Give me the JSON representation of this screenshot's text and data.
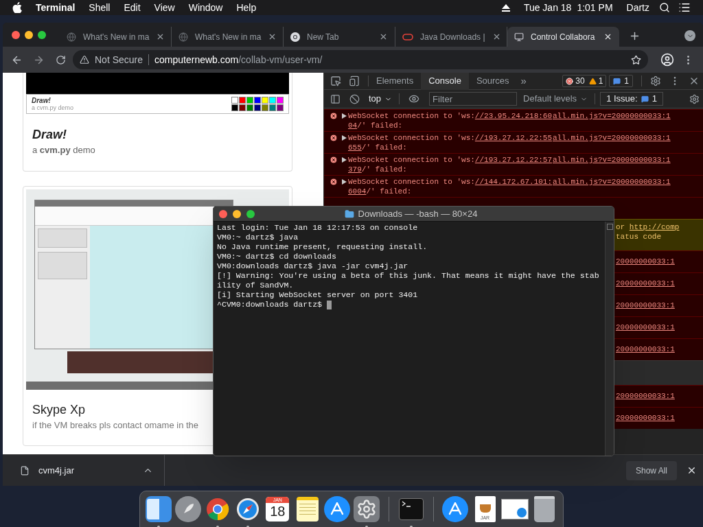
{
  "menu_bar": {
    "app": "Terminal",
    "menus": [
      "Shell",
      "Edit",
      "View",
      "Window",
      "Help"
    ],
    "date": "Tue Jan 18",
    "time": "1:01 PM",
    "user": "Dartz"
  },
  "browser": {
    "tabs": [
      {
        "title": "What's New in ma",
        "kind": "globe",
        "selected": false
      },
      {
        "title": "What's New in ma",
        "kind": "globe",
        "selected": false
      },
      {
        "title": "New Tab",
        "kind": "chrome",
        "selected": false
      },
      {
        "title": "Java Downloads |",
        "kind": "ring",
        "selected": false
      },
      {
        "title": "Control Collabora",
        "kind": "computer",
        "selected": true
      }
    ],
    "address": {
      "security": "Not Secure",
      "domain": "computernewb.com",
      "path": "/collab-vm/user-vm/"
    },
    "page": {
      "cards": [
        {
          "kind": "draw",
          "thumb_title": "Draw!",
          "thumb_caption": "a cvm.py demo",
          "title": "Draw!",
          "description": "a **cvm.py** demo",
          "palette": [
            {
              "color": "#ffffff"
            },
            {
              "color": "#ff0000"
            },
            {
              "color": "#00cc00"
            },
            {
              "color": "#0000ff"
            },
            {
              "color": "#ffff00"
            },
            {
              "color": "#00ffff"
            },
            {
              "color": "#ff00ff"
            },
            {
              "color": "#000000"
            },
            {
              "color": "#800000"
            },
            {
              "color": "#008000"
            },
            {
              "color": "#000080"
            },
            {
              "color": "#808000"
            },
            {
              "color": "#008080"
            },
            {
              "color": "#800080"
            }
          ]
        },
        {
          "kind": "vm",
          "title": "Skype Xp",
          "description": "if the VM breaks pls contact omame in the"
        }
      ]
    },
    "devtools": {
      "tabs": [
        {
          "label": "Elements",
          "selected": false
        },
        {
          "label": "Console",
          "selected": true
        },
        {
          "label": "Sources",
          "selected": false
        }
      ],
      "more": "»",
      "error_count": "30",
      "warning_count": "1",
      "message_count": "1",
      "context": "top",
      "filter_placeholder": "Filter",
      "levels": "Default levels",
      "issues_label": "1 Issue:",
      "issues_count": "1",
      "messages": [
        {
          "text": "WebSocket connection to 'ws:",
          "url_1": "//23.95.24.218:60",
          "url_2": "04",
          "tail": "/' failed:",
          "source": "all.min.js?v=20000000033:1"
        },
        {
          "text": "WebSocket connection to 'ws:",
          "url_1": "//193.27.12.22:55",
          "url_2": "655",
          "tail": "/' failed:",
          "source": "all.min.js?v=20000000033:1"
        },
        {
          "text": "WebSocket connection to 'ws:",
          "url_1": "//193.27.12.22:57",
          "url_2": "379",
          "tail": "/' failed:",
          "source": "all.min.js?v=20000000033:1"
        },
        {
          "text": "WebSocket connection to 'ws:",
          "url_1": "//144.172.67.101:",
          "url_2": "6004",
          "tail": "/' failed:",
          "source": "all.min.js?v=20000000033:1"
        }
      ],
      "partial_rows": [
        {
          "kind": "error"
        },
        {
          "kind": "warning",
          "text": "or",
          "link": "http://comp",
          "text_2": "tatus code"
        },
        {
          "kind": "error",
          "link": "20000000033:1"
        },
        {
          "kind": "error",
          "link": "20000000033:1"
        },
        {
          "kind": "error",
          "link": "20000000033:1"
        },
        {
          "kind": "error",
          "link": "20000000033:1"
        },
        {
          "kind": "error",
          "link": "20000000033:1"
        },
        {
          "kind": "blank"
        },
        {
          "kind": "error",
          "link": "20000000033:1"
        },
        {
          "kind": "error",
          "link": "20000000033:1"
        }
      ]
    },
    "downloads": {
      "file": "cvm4j.jar",
      "show_all": "Show All"
    }
  },
  "terminal": {
    "title": "Downloads — -bash — 80×24",
    "lines": [
      "Last login: Tue Jan 18 12:17:53 on console",
      "VM0:~ dartz$ java",
      "No Java runtime present, requesting install.",
      "VM0:~ dartz$ cd downloads",
      "VM0:downloads dartz$ java -jar cvm4j.jar",
      "[!] Warning: You're using a beta of this junk. That means it might have the stab",
      "ility of SandVM.",
      "[i] Starting WebSocket server on port 3401",
      "^CVM0:downloads dartz$"
    ]
  },
  "dock": {
    "items": [
      {
        "kind": "finder",
        "running": true
      },
      {
        "kind": "launchpad",
        "running": false
      },
      {
        "kind": "chrome",
        "running": true
      },
      {
        "kind": "safari",
        "running": true
      },
      {
        "kind": "calendar",
        "month": "JAN",
        "day": "18",
        "running": false
      },
      {
        "kind": "notes",
        "running": false
      },
      {
        "kind": "appstore",
        "running": false
      },
      {
        "kind": "settings",
        "running": true
      },
      {
        "kind": "separator"
      },
      {
        "kind": "terminal",
        "running": true
      },
      {
        "kind": "separator"
      },
      {
        "kind": "downloads",
        "running": false
      },
      {
        "kind": "jar",
        "label": "JAR",
        "running": false
      },
      {
        "kind": "screenshot",
        "running": false
      },
      {
        "kind": "trash",
        "running": false
      }
    ]
  }
}
